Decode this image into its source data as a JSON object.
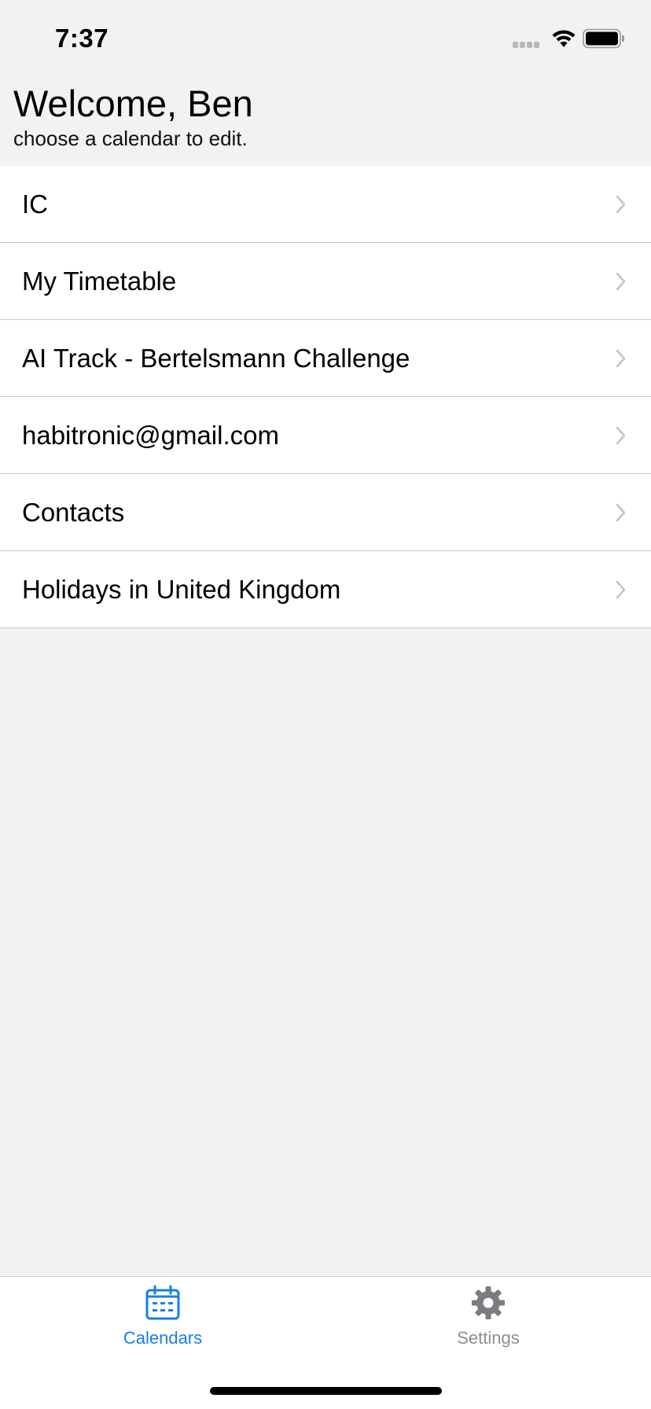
{
  "status_bar": {
    "time": "7:37"
  },
  "header": {
    "title": "Welcome, Ben",
    "subtitle": "choose a calendar to edit."
  },
  "calendars": [
    {
      "label": "IC"
    },
    {
      "label": "My Timetable"
    },
    {
      "label": "AI Track - Bertelsmann Challenge"
    },
    {
      "label": "habitronic@gmail.com"
    },
    {
      "label": "Contacts"
    },
    {
      "label": "Holidays in United Kingdom"
    }
  ],
  "tab_bar": {
    "calendars_label": "Calendars",
    "settings_label": "Settings",
    "active_tab": "Calendars",
    "active_color": "#1a7ee6",
    "inactive_color": "#8e8e93"
  },
  "icons": {
    "calendars_tab": "calendar-icon",
    "settings_tab": "gear-icon",
    "row_disclosure": "chevron-right-icon"
  }
}
